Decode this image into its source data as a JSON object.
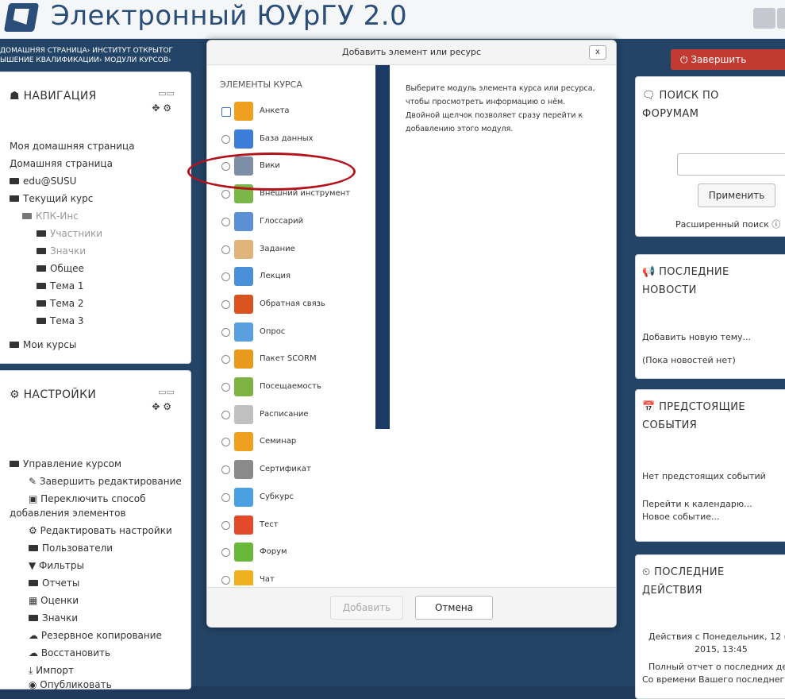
{
  "site": {
    "title": "Электронный ЮУрГУ 2.0"
  },
  "breadcrumb": {
    "line1": "ДОМАШНЯЯ СТРАНИЦА› ИНСТИТУТ ОТКРЫТОГ",
    "line2": "ЫШЕНИЕ КВАЛИФИКАЦИИ› МОДУЛИ КУРСОВ›"
  },
  "finish_button": "Завершить редакти",
  "navigation": {
    "title": "НАВИГАЦИЯ",
    "items": [
      {
        "label": "Моя домашняя страница"
      },
      {
        "label": "Домашняя страница"
      },
      {
        "label": "edu@SUSU"
      },
      {
        "label": "Текущий курс"
      },
      {
        "label": "КПК-Инс"
      },
      {
        "label": "Участники"
      },
      {
        "label": "Значки"
      },
      {
        "label": "Общее"
      },
      {
        "label": "Тема 1"
      },
      {
        "label": "Тема 2"
      },
      {
        "label": "Тема 3"
      },
      {
        "label": "Мои курсы"
      }
    ]
  },
  "settings": {
    "title": "НАСТРОЙКИ",
    "items": [
      {
        "label": "Управление курсом"
      },
      {
        "label": "Завершить редактирование"
      },
      {
        "label": "Переключить способ"
      },
      {
        "label": "добавления элементов"
      },
      {
        "label": "Редактировать настройки"
      },
      {
        "label": "Пользователи"
      },
      {
        "label": "Фильтры"
      },
      {
        "label": "Отчеты"
      },
      {
        "label": "Оценки"
      },
      {
        "label": "Значки"
      },
      {
        "label": "Резервное копирование"
      },
      {
        "label": "Восстановить"
      },
      {
        "label": "Импорт"
      },
      {
        "label": "Опубликовать"
      }
    ]
  },
  "dialog": {
    "title": "Добавить элемент или ресурс",
    "close": "x",
    "list_heading": "ЭЛЕМЕНТЫ КУРСА",
    "items": [
      {
        "label": "Анкета",
        "color": "#f0a020",
        "icon": "chart-icon"
      },
      {
        "label": "База данных",
        "color": "#3b7dd8",
        "icon": "database-icon"
      },
      {
        "label": "Вики",
        "color": "#7d8fa6",
        "icon": "wiki-icon"
      },
      {
        "label": "Внешний инструмент",
        "color": "#7ab648",
        "icon": "puzzle-icon"
      },
      {
        "label": "Глоссарий",
        "color": "#5b8fd6",
        "icon": "glossary-icon"
      },
      {
        "label": "Задание",
        "color": "#e0b47a",
        "icon": "assignment-icon"
      },
      {
        "label": "Лекция",
        "color": "#4b8fd8",
        "icon": "lesson-icon"
      },
      {
        "label": "Обратная связь",
        "color": "#d9531e",
        "icon": "megaphone-icon"
      },
      {
        "label": "Опрос",
        "color": "#5aa0e0",
        "icon": "question-icon"
      },
      {
        "label": "Пакет SCORM",
        "color": "#e89a1c",
        "icon": "scorm-icon"
      },
      {
        "label": "Посещаемость",
        "color": "#7cb342",
        "icon": "attendance-icon"
      },
      {
        "label": "Расписание",
        "color": "#c0c0c0",
        "icon": "calendar-icon"
      },
      {
        "label": "Семинар",
        "color": "#f0a020",
        "icon": "workshop-icon"
      },
      {
        "label": "Сертификат",
        "color": "#8a8a8a",
        "icon": "certificate-icon"
      },
      {
        "label": "Субкурс",
        "color": "#4aa0e0",
        "icon": "subcourse-icon"
      },
      {
        "label": "Тест",
        "color": "#e24a2a",
        "icon": "quiz-icon"
      },
      {
        "label": "Форум",
        "color": "#6ab83a",
        "icon": "forum-icon"
      },
      {
        "label": "Чат",
        "color": "#f0b020",
        "icon": "chat-icon"
      }
    ],
    "description_lines": [
      "Выберите модуль элемента курса или ресурса,",
      "чтобы просмотреть информацию о нём.",
      "Двойной щелчок позволяет сразу перейти к",
      "добавлению этого модуля."
    ],
    "add_button": "Добавить",
    "cancel_button": "Отмена"
  },
  "forum_search": {
    "title_line1": "ПОИСК ПО",
    "title_line2": "ФОРУМАМ",
    "apply_button": "Применить",
    "advanced": "Расширенный поиск"
  },
  "news": {
    "title_line1": "ПОСЛЕДНИЕ",
    "title_line2": "НОВОСТИ",
    "add_topic": "Добавить новую тему...",
    "empty": "(Пока новостей нет)"
  },
  "events": {
    "title_line1": "ПРЕДСТОЯЩИЕ",
    "title_line2": "СОБЫТИЯ",
    "none": "Нет предстоящих событий",
    "goto_calendar": "Перейти к календарю...",
    "new_event": "Новое событие..."
  },
  "activity": {
    "title_line1": "ПОСЛЕДНИЕ",
    "title_line2": "ДЕЙСТВИЯ",
    "since_line1": "Действия с Понедельник, 12 (",
    "since_line2": "2015, 13:45",
    "full_report": "Полный отчет о последних де",
    "since_last": "Со времени Вашего последнег"
  },
  "colors": {
    "accent": "#1b3a66",
    "finish": "#c33a32",
    "highlight": "#b3141b"
  }
}
